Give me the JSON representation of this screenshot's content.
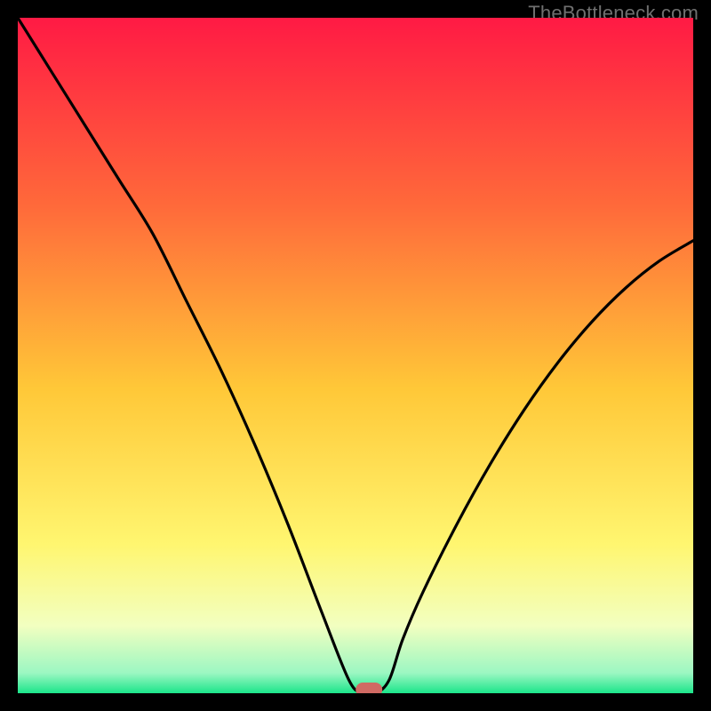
{
  "watermark": "TheBottleneck.com",
  "chart_data": {
    "type": "line",
    "title": "",
    "xlabel": "",
    "ylabel": "",
    "xlim": [
      0,
      100
    ],
    "ylim": [
      0,
      100
    ],
    "background": {
      "type": "vertical-gradient",
      "stops": [
        {
          "pos": 0.0,
          "color": "#ff1a44"
        },
        {
          "pos": 0.28,
          "color": "#ff6a3a"
        },
        {
          "pos": 0.55,
          "color": "#ffc838"
        },
        {
          "pos": 0.78,
          "color": "#fff670"
        },
        {
          "pos": 0.9,
          "color": "#f2ffc0"
        },
        {
          "pos": 0.97,
          "color": "#9cf7c2"
        },
        {
          "pos": 1.0,
          "color": "#1be58a"
        }
      ]
    },
    "series": [
      {
        "name": "bottleneck-curve",
        "x": [
          0,
          5,
          10,
          15,
          20,
          25,
          30,
          35,
          40,
          45,
          49,
          51,
          53,
          55,
          57,
          60,
          65,
          70,
          75,
          80,
          85,
          90,
          95,
          100
        ],
        "y": [
          100,
          92,
          84,
          76,
          68,
          58,
          48,
          37,
          25,
          12,
          2,
          0,
          0,
          2,
          8,
          15,
          25,
          34,
          42,
          49,
          55,
          60,
          64,
          67
        ]
      }
    ],
    "marker": {
      "name": "optimal-point",
      "x": 52,
      "y": 0,
      "color": "#d06a63"
    },
    "colors": {
      "curve": "#000000",
      "frame": "#000000",
      "marker": "#d06a63"
    }
  }
}
